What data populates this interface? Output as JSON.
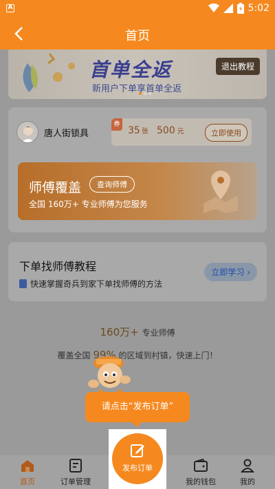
{
  "status_bar": {
    "time": "5:02"
  },
  "nav": {
    "title": "首页"
  },
  "banner": {
    "title": "首单全返",
    "subtitle": "新用户下单享首单全返",
    "exit_label": "退出教程"
  },
  "store": {
    "name": "唐人街锁具"
  },
  "coupon": {
    "tag": "券",
    "count": "35",
    "count_unit": "张",
    "amount": "500",
    "amount_unit": "元",
    "use_label": "立即使用"
  },
  "master": {
    "heading": "师傅覆盖",
    "query_label": "查询师傅",
    "description": "全国 160万+ 专业师傅为您服务"
  },
  "tutorial": {
    "heading": "下单找师傅教程",
    "description": "快速掌握奇兵到家下单找师傅的方法",
    "learn_label": "立即学习"
  },
  "stats": {
    "count": "160万+",
    "count_suffix": "专业师傅",
    "coverage_prefix": "覆盖全国",
    "percent": "99%",
    "coverage_suffix": "的区域到村镇，快速上门！"
  },
  "tooltip": {
    "text": "请点击“发布订单”"
  },
  "tabs": [
    {
      "label": "首页"
    },
    {
      "label": "订单管理"
    },
    {
      "label": "发布订单"
    },
    {
      "label": "我的钱包"
    },
    {
      "label": "我的"
    }
  ]
}
